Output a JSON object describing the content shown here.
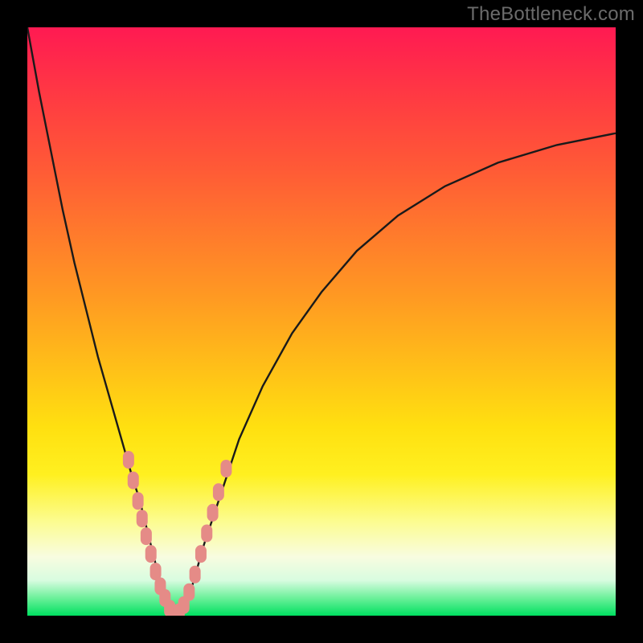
{
  "watermark": "TheBottleneck.com",
  "colors": {
    "background": "#000000",
    "curve": "#1a1a1a",
    "marker_fill": "#e58b87",
    "gradient_top": "#ff1a52",
    "gradient_bottom": "#00e060"
  },
  "chart_data": {
    "type": "line",
    "title": "",
    "xlabel": "",
    "ylabel": "",
    "xlim": [
      0,
      100
    ],
    "ylim": [
      0,
      100
    ],
    "grid": false,
    "series": [
      {
        "name": "bottleneck-curve",
        "x": [
          0,
          2,
          4,
          6,
          8,
          10,
          12,
          14,
          16,
          18,
          19,
          20,
          21,
          22,
          23,
          24,
          25,
          26,
          28,
          30,
          33,
          36,
          40,
          45,
          50,
          56,
          63,
          71,
          80,
          90,
          100
        ],
        "y": [
          100,
          89,
          79,
          69,
          60,
          52,
          44,
          37,
          30,
          23,
          20,
          16,
          12,
          8,
          4,
          1,
          0,
          1,
          5,
          12,
          21,
          30,
          39,
          48,
          55,
          62,
          68,
          73,
          77,
          80,
          82
        ]
      }
    ],
    "markers": [
      {
        "series": "bottleneck-curve",
        "x": 17.2,
        "y": 26.5
      },
      {
        "series": "bottleneck-curve",
        "x": 18.0,
        "y": 23.0
      },
      {
        "series": "bottleneck-curve",
        "x": 18.8,
        "y": 19.5
      },
      {
        "series": "bottleneck-curve",
        "x": 19.5,
        "y": 16.5
      },
      {
        "series": "bottleneck-curve",
        "x": 20.2,
        "y": 13.5
      },
      {
        "series": "bottleneck-curve",
        "x": 21.0,
        "y": 10.5
      },
      {
        "series": "bottleneck-curve",
        "x": 21.8,
        "y": 7.5
      },
      {
        "series": "bottleneck-curve",
        "x": 22.6,
        "y": 5.0
      },
      {
        "series": "bottleneck-curve",
        "x": 23.4,
        "y": 3.0
      },
      {
        "series": "bottleneck-curve",
        "x": 24.2,
        "y": 1.2
      },
      {
        "series": "bottleneck-curve",
        "x": 25.0,
        "y": 0.4
      },
      {
        "series": "bottleneck-curve",
        "x": 25.8,
        "y": 0.6
      },
      {
        "series": "bottleneck-curve",
        "x": 26.6,
        "y": 1.8
      },
      {
        "series": "bottleneck-curve",
        "x": 27.5,
        "y": 4.0
      },
      {
        "series": "bottleneck-curve",
        "x": 28.5,
        "y": 7.0
      },
      {
        "series": "bottleneck-curve",
        "x": 29.5,
        "y": 10.5
      },
      {
        "series": "bottleneck-curve",
        "x": 30.5,
        "y": 14.0
      },
      {
        "series": "bottleneck-curve",
        "x": 31.5,
        "y": 17.5
      },
      {
        "series": "bottleneck-curve",
        "x": 32.5,
        "y": 21.0
      },
      {
        "series": "bottleneck-curve",
        "x": 33.8,
        "y": 25.0
      }
    ]
  }
}
